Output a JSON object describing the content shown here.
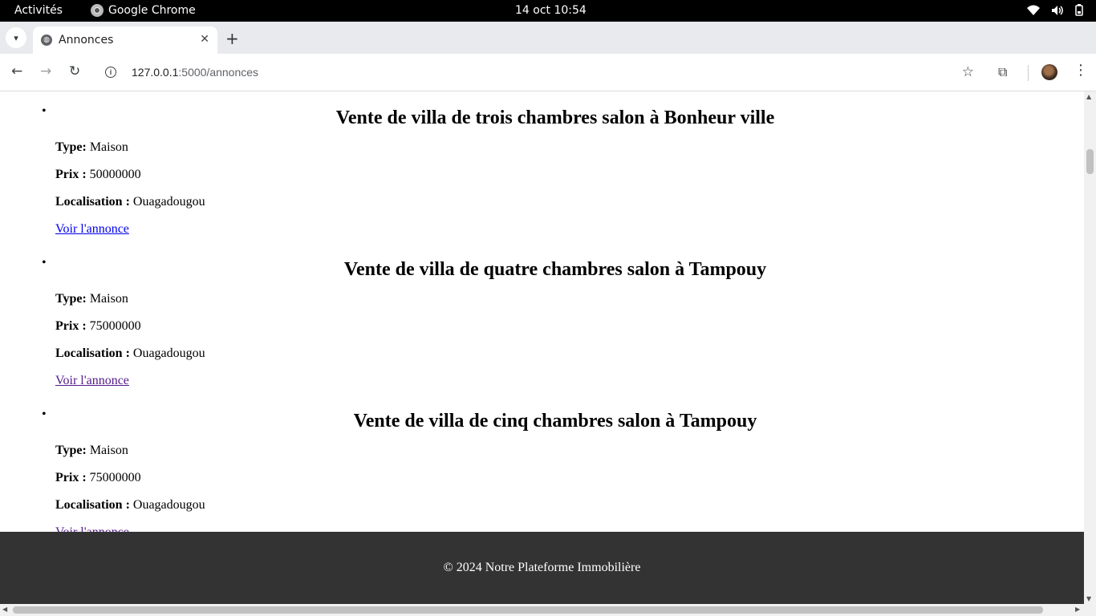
{
  "system_bar": {
    "activities": "Activités",
    "app_name": "Google Chrome",
    "clock": "14 oct  10:54"
  },
  "browser": {
    "tab_title": "Annonces",
    "url_host": "127.0.0.1",
    "url_path": ":5000/annonces",
    "icons": [
      "chevron-down-icon",
      "globe-icon",
      "close-icon",
      "plus-icon",
      "back-icon",
      "forward-icon",
      "reload-icon",
      "info-icon",
      "star-icon",
      "extensions-icon",
      "avatar",
      "more-vert-icon",
      "wifi-icon",
      "volume-icon",
      "battery-icon"
    ]
  },
  "page": {
    "labels": {
      "type": "Type:",
      "price": "Prix :",
      "location": "Localisation :"
    },
    "listings": [
      {
        "title": "Vente de villa de trois chambres salon à Bonheur ville",
        "type": "Maison",
        "price": "50000000",
        "location": "Ouagadougou",
        "link": "Voir l'annonce",
        "visited": false
      },
      {
        "title": "Vente de villa de quatre chambres salon à Tampouy",
        "type": "Maison",
        "price": "75000000",
        "location": "Ouagadougou",
        "link": "Voir l'annonce",
        "visited": true
      },
      {
        "title": "Vente de villa de cinq chambres salon à Tampouy",
        "type": "Maison",
        "price": "75000000",
        "location": "Ouagadougou",
        "link": "Voir l'annonce",
        "visited": true
      }
    ],
    "footer": "© 2024 Notre Plateforme Immobilière"
  }
}
